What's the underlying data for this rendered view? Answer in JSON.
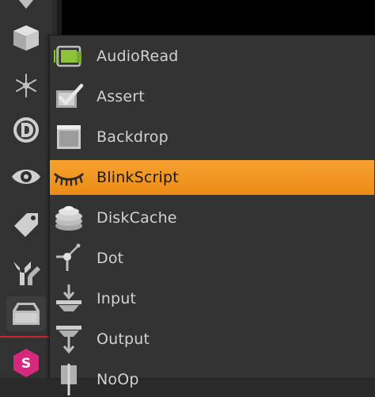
{
  "toolbar": {
    "tools": [
      {
        "id": "image",
        "icon": "down-arrow-icon"
      },
      {
        "id": "3d",
        "icon": "cube-icon"
      },
      {
        "id": "particles",
        "icon": "snowflake-icon"
      },
      {
        "id": "deep",
        "icon": "deep-d-icon"
      },
      {
        "id": "views",
        "icon": "eye-icon"
      },
      {
        "id": "metadata",
        "icon": "tag-icon"
      },
      {
        "id": "toolsets",
        "icon": "wrench-icon"
      },
      {
        "id": "other",
        "icon": "drawer-icon",
        "active": true
      },
      {
        "id": "smartvector",
        "icon": "s-hexagon-icon"
      }
    ]
  },
  "menu": {
    "items": [
      {
        "label": "AudioRead",
        "icon": "audio-read-icon"
      },
      {
        "label": "Assert",
        "icon": "checkbox-icon"
      },
      {
        "label": "Backdrop",
        "icon": "backdrop-icon"
      },
      {
        "label": "BlinkScript",
        "icon": "blink-eye-icon",
        "highlighted": true
      },
      {
        "label": "DiskCache",
        "icon": "disk-cache-icon"
      },
      {
        "label": "Dot",
        "icon": "dot-node-icon"
      },
      {
        "label": "Input",
        "icon": "input-node-icon"
      },
      {
        "label": "Output",
        "icon": "output-node-icon"
      },
      {
        "label": "NoOp",
        "icon": "noop-node-icon"
      }
    ]
  },
  "colors": {
    "highlight": "#f39a22",
    "menu_bg": "#333333",
    "toolbar_bg": "#323232",
    "accent_red": "#c8242a",
    "smart_vector": "#d4297d"
  }
}
